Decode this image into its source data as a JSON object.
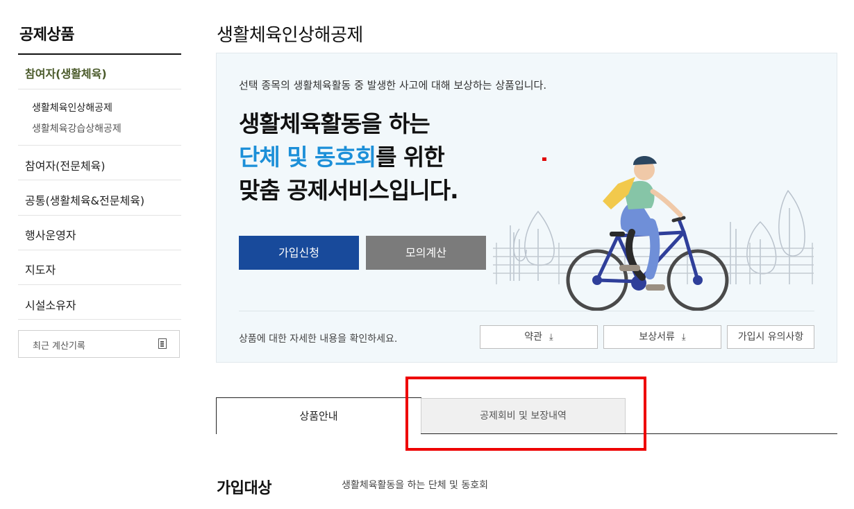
{
  "sidebar": {
    "title": "공제상품",
    "active_group": "참여자(생활체육)",
    "sub_items": [
      "생활체육인상해공제",
      "생활체육강습상해공제"
    ],
    "items": [
      "참여자(전문체육)",
      "공통(생활체육&전문체육)",
      "행사운영자",
      "지도자",
      "시설소유자"
    ],
    "recent_label": "최근 계산기록",
    "recent_icon": "document-list-icon"
  },
  "page": {
    "title": "생활체육인상해공제"
  },
  "hero": {
    "description": "선택 종목의 생활체육활동 중 발생한 사고에 대해 보상하는 상품입니다.",
    "headline_line1": "생활체육활동을 하는",
    "headline_line2_highlight": "단체 및 동호회",
    "headline_line2_rest": "를 위한",
    "headline_line3": "맞춤 공제서비스입니다.",
    "join_label": "가입신청",
    "simulate_label": "모의계산",
    "detail_text": "상품에 대한 자세한 내용을 확인하세요.",
    "doc_buttons": [
      "약관",
      "보상서류",
      "가입시 유의사항"
    ],
    "download_icon": "download-icon",
    "colors": {
      "highlight": "#1c8fd8",
      "join_bg": "#184a9b",
      "simulate_bg": "#7b7b7b",
      "hero_bg": "#f2f8fb"
    }
  },
  "tabs": [
    "상품안내",
    "공제회비 및 보장내역"
  ],
  "section": {
    "title": "가입대상",
    "value": "생활체육활동을 하는 단체 및 동호회"
  }
}
